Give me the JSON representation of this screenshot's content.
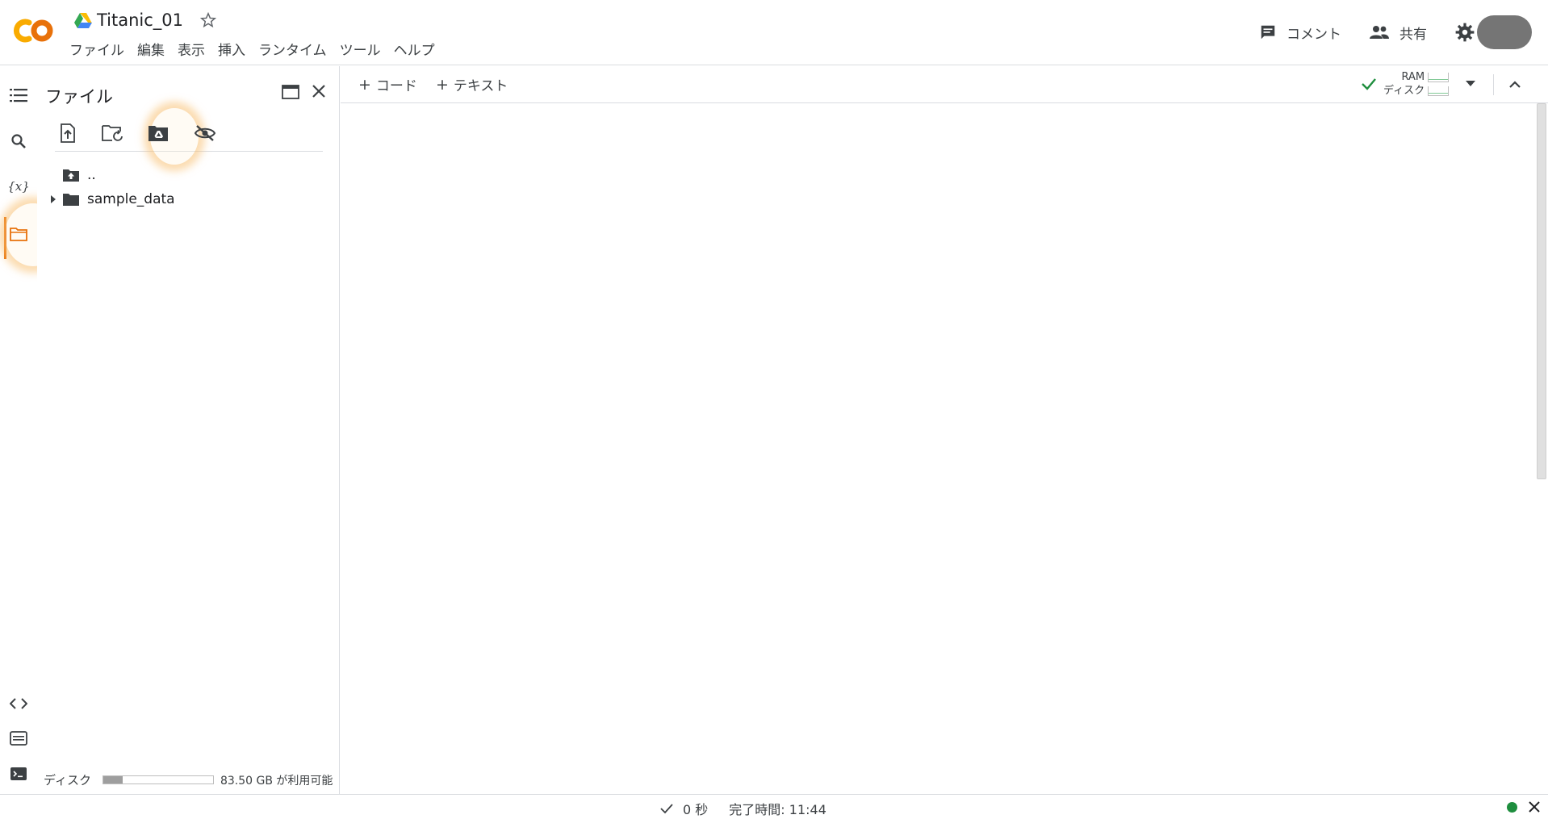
{
  "header": {
    "title": "Titanic_01",
    "menu": [
      "ファイル",
      "編集",
      "表示",
      "挿入",
      "ランタイム",
      "ツール",
      "ヘルプ"
    ],
    "comment_label": "コメント",
    "share_label": "共有"
  },
  "files_panel": {
    "title": "ファイル",
    "tree": [
      {
        "label": ".."
      },
      {
        "label": "sample_data"
      }
    ],
    "disk_label": "ディスク",
    "disk_info": "83.50 GB が利用可能",
    "disk_used_fraction": 0.18
  },
  "toolbar": {
    "add_code": "コード",
    "add_text": "テキスト",
    "ram_label": "RAM",
    "disk_label": "ディスク"
  },
  "status": {
    "duration": "0 秒",
    "completed": "完了時間: 11:44"
  },
  "colors": {
    "accent": "#e8710a",
    "logo_orange": "#f9ab00",
    "status_ok": "#1e8e3e",
    "highlight": "#f7be6e"
  }
}
